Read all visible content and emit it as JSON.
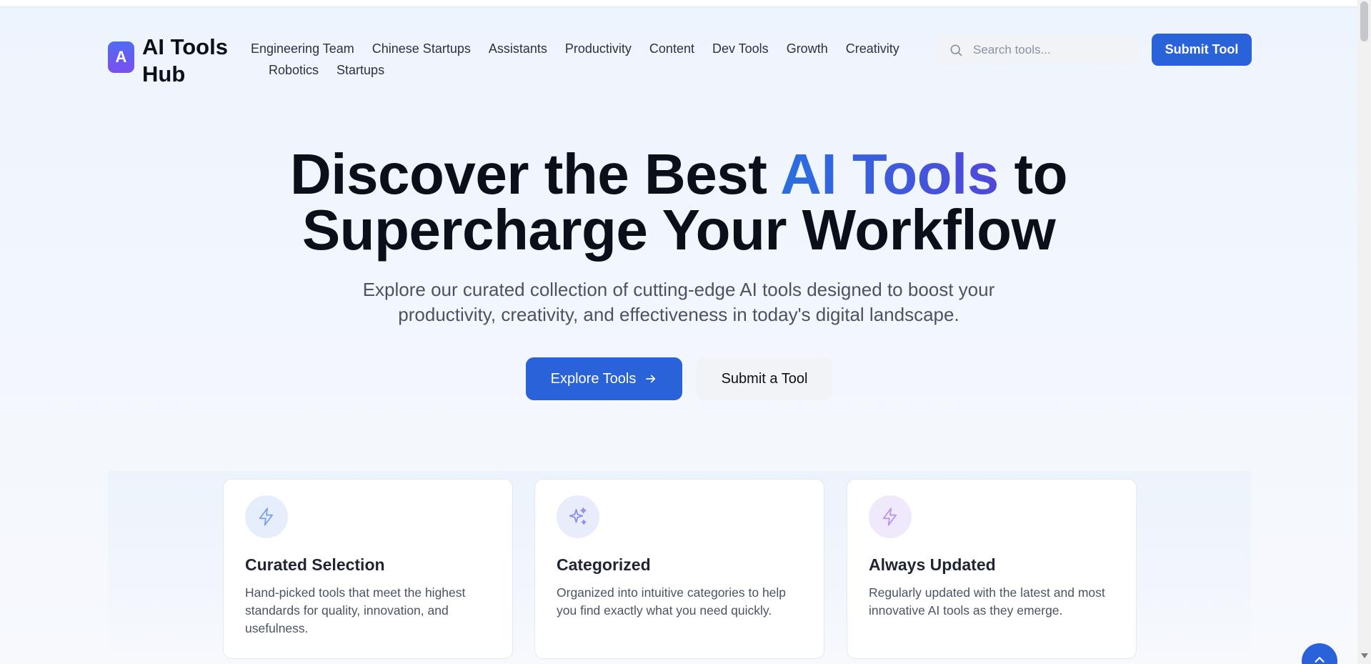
{
  "header": {
    "logo_letter": "A",
    "logo_text": "AI Tools Hub",
    "nav_row1": [
      "Engineering Team",
      "Chinese Startups",
      "Assistants",
      "Productivity",
      "Content",
      "Dev Tools",
      "Growth",
      "Creativity"
    ],
    "nav_row2": [
      "Robotics",
      "Startups"
    ],
    "search_placeholder": "Search tools...",
    "submit_label": "Submit Tool"
  },
  "hero": {
    "title_part1": "Discover the Best ",
    "title_accent": "AI Tools",
    "title_part2": " to",
    "title_line2": "Supercharge Your Workflow",
    "subtitle": "Explore our curated collection of cutting-edge AI tools designed to boost your productivity, creativity, and effectiveness in today's digital landscape.",
    "primary_cta": "Explore Tools",
    "secondary_cta": "Submit a Tool"
  },
  "features": [
    {
      "icon": "lightning-icon",
      "title": "Curated Selection",
      "text": "Hand-picked tools that meet the highest standards for quality, innovation, and usefulness."
    },
    {
      "icon": "sparkles-icon",
      "title": "Categorized",
      "text": "Organized into intuitive categories to help you find exactly what you need quickly."
    },
    {
      "icon": "lightning-icon",
      "title": "Always Updated",
      "text": "Regularly updated with the latest and most innovative AI tools as they emerge."
    }
  ],
  "colors": {
    "primary": "#2a62d9",
    "accent_gradient_start": "#2a6fe0",
    "accent_gradient_end": "#5147d8",
    "logo_gradient_start": "#4f6cf2",
    "logo_gradient_end": "#7b4ff0"
  }
}
